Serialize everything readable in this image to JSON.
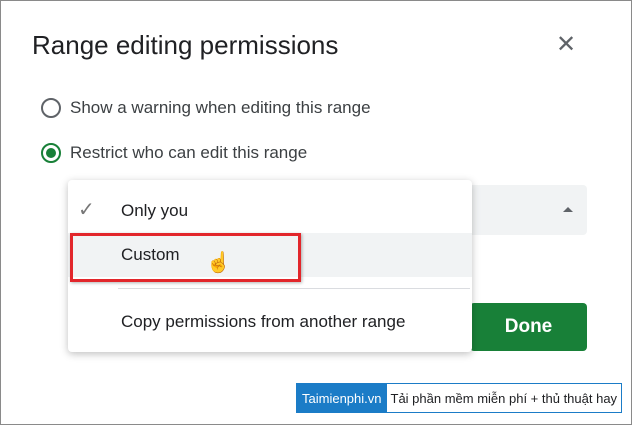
{
  "dialog": {
    "title": "Range editing permissions",
    "close_icon": "close-icon",
    "options": [
      {
        "label": "Show a warning when editing this range",
        "selected": false
      },
      {
        "label": "Restrict who can edit this range",
        "selected": true
      }
    ],
    "done_label": "Done"
  },
  "menu": {
    "items": [
      {
        "label": "Only you",
        "checked": true
      },
      {
        "label": "Custom",
        "hovered": true
      },
      {
        "label": "Copy permissions from another range"
      }
    ]
  },
  "watermark": {
    "brand": "Taimienphi.vn",
    "tagline": "Tải phần mềm miễn phí + thủ thuật hay"
  },
  "colors": {
    "accent": "#188038",
    "highlight": "#e2262b"
  }
}
